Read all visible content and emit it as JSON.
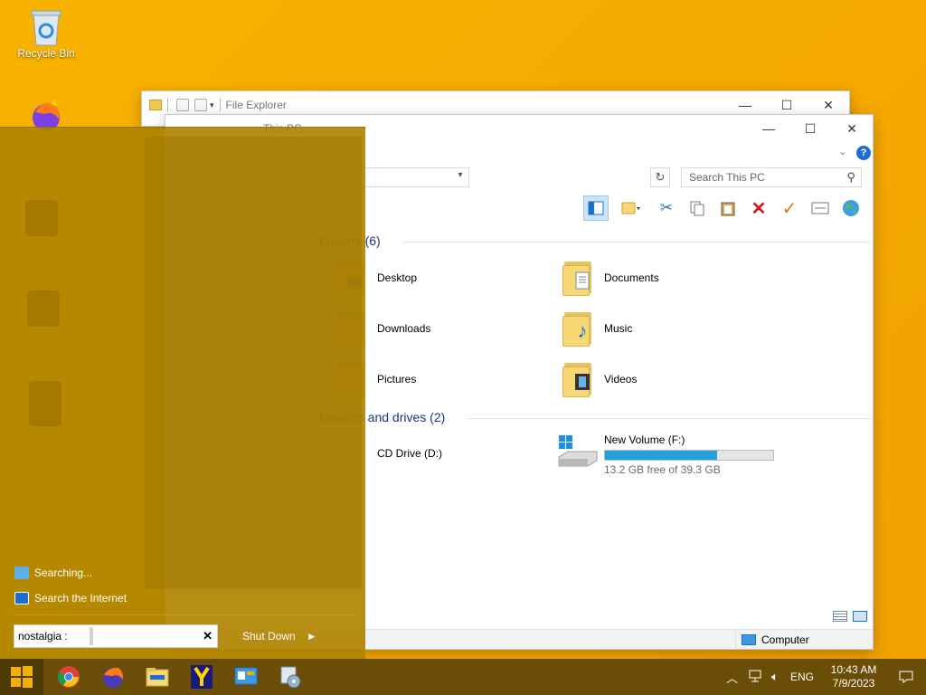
{
  "desktop": {
    "icons": [
      {
        "label": "Recycle Bin",
        "icon": "recycle-bin-icon"
      }
    ]
  },
  "back_window": {
    "title": "File Explorer",
    "controls": [
      "minimize",
      "maximize",
      "close"
    ]
  },
  "front_window": {
    "title": "This PC",
    "search_placeholder": "Search This PC",
    "folders_section": "Folders (6)",
    "folders": [
      {
        "label": "Desktop"
      },
      {
        "label": "Documents"
      },
      {
        "label": "Downloads"
      },
      {
        "label": "Music"
      },
      {
        "label": "Pictures"
      },
      {
        "label": "Videos"
      }
    ],
    "drives_section": "Devices and drives (2)",
    "drives": [
      {
        "label": "CD Drive (D:)"
      },
      {
        "label": "New Volume (F:)",
        "free_text": "13.2 GB free of 39.3 GB",
        "used_fraction": 0.664
      }
    ],
    "status_location": "Computer"
  },
  "start_menu": {
    "results": [
      "Searching...",
      "Search the Internet"
    ],
    "search_value": "nostalgia :",
    "shutdown_label": "Shut Down"
  },
  "taskbar": {
    "apps": [
      "start-icon",
      "chrome-icon",
      "firefox-icon",
      "file-explorer-icon",
      "yandex-icon",
      "control-panel-icon",
      "disk-utility-icon"
    ],
    "tray": {
      "language": "ENG",
      "time": "10:43 AM",
      "date": "7/9/2023"
    }
  },
  "colors": {
    "desktop": "#f5aa00",
    "start_menu": "#b08400",
    "taskbar": "#6a4d07",
    "drive_bar": "#26a0da",
    "section_heading": "#1e3287"
  }
}
